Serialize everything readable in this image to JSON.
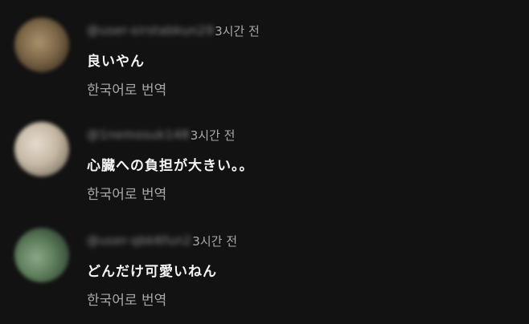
{
  "comments": [
    {
      "handle": "@user-sirstabkun29",
      "time": "3시간 전",
      "text": "良いやん",
      "translate_label": "한국어로 번역"
    },
    {
      "handle": "@1nemosuk148",
      "time": "3시간 전",
      "text": "心臓への負担が大きい。。",
      "translate_label": "한국어로 번역"
    },
    {
      "handle": "@user-qbk6fun2",
      "time": "3시간 전",
      "text": "どんだけ可愛いねん",
      "translate_label": "한국어로 번역"
    }
  ]
}
